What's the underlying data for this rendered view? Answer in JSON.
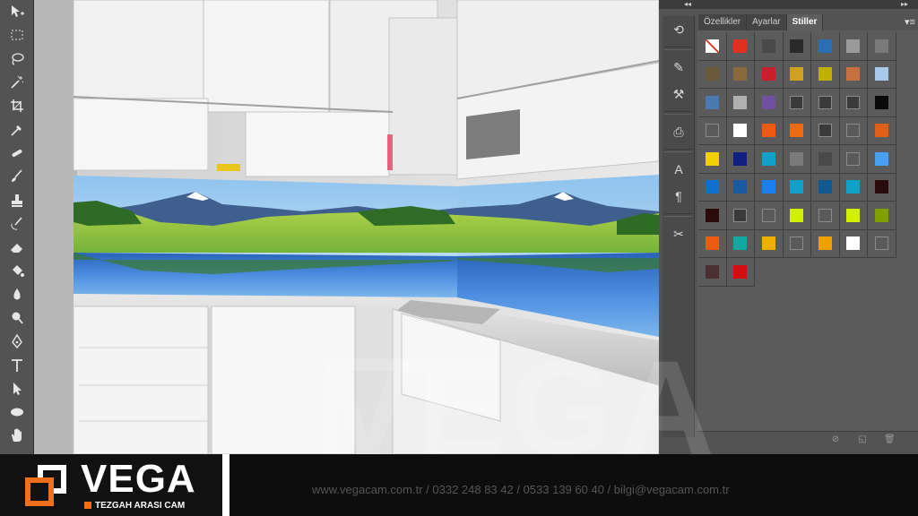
{
  "toolbar": {
    "tools": [
      "move-tool",
      "marquee-tool",
      "lasso-tool",
      "magic-wand-tool",
      "crop-tool",
      "eyedropper-tool",
      "healing-tool",
      "brush-tool",
      "clone-stamp-tool",
      "history-brush-tool",
      "eraser-tool",
      "paint-bucket-tool",
      "blur-tool",
      "dodge-tool",
      "pen-tool",
      "type-tool",
      "path-selection-tool",
      "ellipse-tool",
      "hand-tool"
    ]
  },
  "panel": {
    "tabs": [
      "Özellikler",
      "Ayarlar",
      "Stiller"
    ],
    "active_tab": "Stiller",
    "collapse_left": "◂◂",
    "collapse_right": "▸▸",
    "menu_icon": "▾≡",
    "strip_icons": [
      "history-icon",
      "brush-preset-icon",
      "tool-preset-icon",
      "clone-source-icon",
      "character-icon",
      "paragraph-icon",
      "tools-icon"
    ],
    "styles": [
      "#ffffff",
      "#e0301e",
      "#4a4a4a",
      "#2a2a2a",
      "#2b6fb3",
      "#9a9a9a",
      "#7a7a7a",
      "#6b5a3a",
      "#8a6a3a",
      "#c8202a",
      "#d0a020",
      "#c0b000",
      "#c87040",
      "#a8c8e8",
      "#4a7ab0",
      "#b0b0b0",
      "#7050a0",
      "#3a3a3a",
      "#3a3a3a",
      "#3a3a3a",
      "#0a0a0a",
      "#5a5a5a",
      "#ffffff",
      "#f05a10",
      "#f06a10",
      "#3a3a3a",
      "#5a5a5a",
      "#e06018",
      "#f0d000",
      "#102080",
      "#10a0c8",
      "#7a7a7a",
      "#4a4a4a",
      "#5a5a5a",
      "#4aa0f0",
      "#1070d0",
      "#1a5aa0",
      "#1a80f0",
      "#10a0c8",
      "#105a90",
      "#10a0c8",
      "#2a0a0a",
      "#2a0a0a",
      "#3a3a3a",
      "#5a5a5a",
      "#d0f000",
      "#5a5a5a",
      "#d0f000",
      "#80a000",
      "#f05a10",
      "#10a8a0",
      "#f0b000",
      "#5a5a5a",
      "#f0a000",
      "#ffffff",
      "#5a5a5a",
      "#4a3030",
      "#d01010"
    ],
    "footer_icons": [
      "no-icon",
      "new-style-icon",
      "trash-icon"
    ]
  },
  "watermark": {
    "text": "VEGA"
  },
  "footer": {
    "logo_text": "VEGA",
    "logo_sub": "TEZGAH ARASI CAM",
    "contact": "www.vegacam.com.tr / 0332 248 83 42 / 0533 139 60 40 / bilgi@vegacam.com.tr",
    "accent": "#ef6f1d"
  }
}
